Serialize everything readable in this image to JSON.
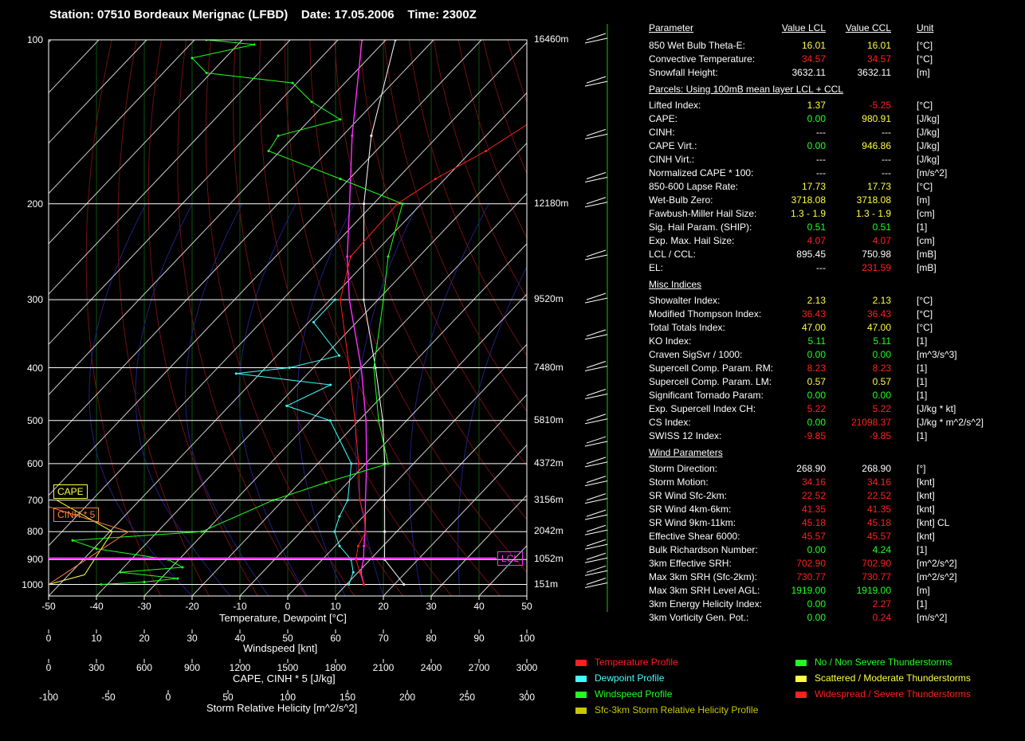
{
  "header": {
    "station": "Station: 07510 Bordeaux Merignac (LFBD)",
    "date": "Date: 17.05.2006",
    "time": "Time: 2300Z"
  },
  "colors": {
    "background": "#000000",
    "temperature": "#ff2020",
    "dewpoint": "#40ffff",
    "wind": "#20ff20",
    "parcel": "#ff30ff",
    "virt": "#ffffff",
    "srh": "#c8c800",
    "yellow": "#ffff40",
    "red": "#ff2020",
    "green": "#20ff20"
  },
  "chart_data": {
    "type": "line",
    "x_axis": {
      "label": "Temperature, Dewpoint  [°C]",
      "ticks": [
        "-50",
        "-40",
        "-30",
        "-20",
        "-10",
        "0",
        "10",
        "20",
        "30",
        "40",
        "50"
      ],
      "range": [
        -50,
        50
      ]
    },
    "wind_axis": {
      "label": "Windspeed  [knt]",
      "ticks": [
        "0",
        "10",
        "20",
        "30",
        "40",
        "50",
        "60",
        "70",
        "80",
        "90",
        "100"
      ]
    },
    "cape_axis": {
      "label": "CAPE, CINH * 5  [J/kg]",
      "ticks": [
        "0",
        "300",
        "600",
        "900",
        "1200",
        "1500",
        "1800",
        "2100",
        "2400",
        "2700",
        "3000"
      ]
    },
    "srh_axis": {
      "label": "Storm Relative Helicity  [m^2/s^2]",
      "ticks": [
        "-100",
        "-50",
        "0",
        "50",
        "100",
        "150",
        "200",
        "250",
        "300"
      ]
    },
    "pressure_levels": [
      {
        "p": 100,
        "label": "100",
        "height": "16460m"
      },
      {
        "p": 200,
        "label": "200",
        "height": "12180m"
      },
      {
        "p": 300,
        "label": "300",
        "height": "9520m"
      },
      {
        "p": 400,
        "label": "400",
        "height": "7480m"
      },
      {
        "p": 500,
        "label": "500",
        "height": "5810m"
      },
      {
        "p": 600,
        "label": "600",
        "height": "4372m"
      },
      {
        "p": 700,
        "label": "700",
        "height": "3156m"
      },
      {
        "p": 800,
        "label": "800",
        "height": "2042m"
      },
      {
        "p": 900,
        "label": "900",
        "height": "1052m"
      },
      {
        "p": 1000,
        "label": "1000",
        "height": "151m"
      }
    ],
    "temperature": [
      {
        "p": 1000,
        "t": 13.6
      },
      {
        "p": 950,
        "t": 10.4
      },
      {
        "p": 900,
        "t": 7.0
      },
      {
        "p": 850,
        "t": 4.8
      },
      {
        "p": 800,
        "t": 3.5
      },
      {
        "p": 750,
        "t": 0.2
      },
      {
        "p": 700,
        "t": -4.0
      },
      {
        "p": 600,
        "t": -11.5
      },
      {
        "p": 500,
        "t": -20.8
      },
      {
        "p": 400,
        "t": -32.5
      },
      {
        "p": 300,
        "t": -47.9
      },
      {
        "p": 250,
        "t": -54.3
      },
      {
        "p": 200,
        "t": -55.0
      },
      {
        "p": 180,
        "t": -52.0
      },
      {
        "p": 160,
        "t": -47.0
      },
      {
        "p": 140,
        "t": -43.0
      },
      {
        "p": 120,
        "t": -40.0
      },
      {
        "p": 110,
        "t": -39.0
      }
    ],
    "dewpoint": [
      {
        "p": 1000,
        "t": 10.5
      },
      {
        "p": 950,
        "t": 9.0
      },
      {
        "p": 900,
        "t": 6.0
      },
      {
        "p": 850,
        "t": 0.9
      },
      {
        "p": 800,
        "t": -3.0
      },
      {
        "p": 750,
        "t": -5.0
      },
      {
        "p": 700,
        "t": -6.5
      },
      {
        "p": 600,
        "t": -13.0
      },
      {
        "p": 500,
        "t": -26.0
      },
      {
        "p": 470,
        "t": -38.0
      },
      {
        "p": 430,
        "t": -33.0
      },
      {
        "p": 410,
        "t": -55.0
      },
      {
        "p": 400,
        "t": -45.0
      },
      {
        "p": 380,
        "t": -37.0
      },
      {
        "p": 330,
        "t": -49.0
      },
      {
        "p": 300,
        "t": -49.0
      }
    ],
    "parcel": [
      {
        "p": 1000,
        "t": 13.6
      },
      {
        "p": 950,
        "t": 10.6
      },
      {
        "p": 900,
        "t": 8.6
      },
      {
        "p": 850,
        "t": 6.0
      },
      {
        "p": 800,
        "t": 3.4
      },
      {
        "p": 700,
        "t": -2.8
      },
      {
        "p": 600,
        "t": -9.8
      },
      {
        "p": 500,
        "t": -18.5
      },
      {
        "p": 400,
        "t": -30.0
      },
      {
        "p": 300,
        "t": -46.0
      },
      {
        "p": 250,
        "t": -55.0
      },
      {
        "p": 200,
        "t": -65.0
      },
      {
        "p": 150,
        "t": -78.0
      },
      {
        "p": 100,
        "t": -95.0
      }
    ],
    "virtual": [
      {
        "p": 1000,
        "t": 22.0
      },
      {
        "p": 900,
        "t": 13.0
      },
      {
        "p": 800,
        "t": 7.5
      },
      {
        "p": 700,
        "t": 1.2
      },
      {
        "p": 600,
        "t": -6.0
      },
      {
        "p": 500,
        "t": -15.0
      },
      {
        "p": 400,
        "t": -27.0
      },
      {
        "p": 300,
        "t": -43.0
      },
      {
        "p": 200,
        "t": -62.0
      },
      {
        "p": 150,
        "t": -74.0
      },
      {
        "p": 100,
        "t": -88.0
      }
    ],
    "windspeed": [
      {
        "p": 1000,
        "v": 11
      },
      {
        "p": 990,
        "v": 20
      },
      {
        "p": 975,
        "v": 27
      },
      {
        "p": 950,
        "v": 15
      },
      {
        "p": 930,
        "v": 28
      },
      {
        "p": 900,
        "v": 25
      },
      {
        "p": 860,
        "v": 10
      },
      {
        "p": 830,
        "v": 5
      },
      {
        "p": 800,
        "v": 32
      },
      {
        "p": 700,
        "v": 47
      },
      {
        "p": 650,
        "v": 58
      },
      {
        "p": 600,
        "v": 71
      },
      {
        "p": 500,
        "v": 69
      },
      {
        "p": 400,
        "v": 68
      },
      {
        "p": 300,
        "v": 70
      },
      {
        "p": 250,
        "v": 71
      },
      {
        "p": 200,
        "v": 74
      },
      {
        "p": 180,
        "v": 61
      },
      {
        "p": 160,
        "v": 46
      },
      {
        "p": 150,
        "v": 48
      },
      {
        "p": 140,
        "v": 61
      },
      {
        "p": 130,
        "v": 55
      },
      {
        "p": 120,
        "v": 51
      },
      {
        "p": 115,
        "v": 33
      },
      {
        "p": 108,
        "v": 30
      },
      {
        "p": 102,
        "v": 43
      },
      {
        "p": 100,
        "v": 33
      }
    ],
    "indicators": {
      "cape_label": "CAPE",
      "cinh_label": "CINH * 5",
      "lcl_label": "LCL"
    }
  },
  "table": {
    "header": {
      "name": "Parameter",
      "lcl": "Value LCL",
      "ccl": "Value CCL",
      "unit": "Unit"
    },
    "rows": [
      {
        "name": "850 Wet Bulb Theta-E:",
        "lcl": "16.01",
        "ccl": "16.01",
        "unit": "[°C]",
        "cl": "yellow",
        "cc": "yellow"
      },
      {
        "name": "Convective Temperature:",
        "lcl": "34.57",
        "ccl": "34.57",
        "unit": "[°C]",
        "cl": "red",
        "cc": "red"
      },
      {
        "name": "Snowfall Height:",
        "lcl": "3632.11",
        "ccl": "3632.11",
        "unit": "[m]",
        "cl": "white",
        "cc": "white"
      },
      {
        "section": "Parcels: Using 100mB mean layer LCL + CCL"
      },
      {
        "name": "Lifted Index:",
        "lcl": "1.37",
        "ccl": "-5.25",
        "unit": "[°C]",
        "cl": "yellow",
        "cc": "red"
      },
      {
        "name": "CAPE:",
        "lcl": "0.00",
        "ccl": "980.91",
        "unit": "[J/kg]",
        "cl": "green",
        "cc": "yellow"
      },
      {
        "name": "CINH:",
        "lcl": "---",
        "ccl": "---",
        "unit": "[J/kg]",
        "cl": "white",
        "cc": "white"
      },
      {
        "name": "CAPE Virt.:",
        "lcl": "0.00",
        "ccl": "946.86",
        "unit": "[J/kg]",
        "cl": "green",
        "cc": "yellow"
      },
      {
        "name": "CINH Virt.:",
        "lcl": "---",
        "ccl": "---",
        "unit": "[J/kg]",
        "cl": "white",
        "cc": "white"
      },
      {
        "name": "Normalized CAPE * 100:",
        "lcl": "---",
        "ccl": "---",
        "unit": "[m/s^2]",
        "cl": "white",
        "cc": "white"
      },
      {
        "name": "850-600 Lapse Rate:",
        "lcl": "17.73",
        "ccl": "17.73",
        "unit": "[°C]",
        "cl": "yellow",
        "cc": "yellow"
      },
      {
        "name": "Wet-Bulb Zero:",
        "lcl": "3718.08",
        "ccl": "3718.08",
        "unit": "[m]",
        "cl": "yellow",
        "cc": "yellow"
      },
      {
        "name": "Fawbush-Miller Hail Size:",
        "lcl": "1.3 - 1.9",
        "ccl": "1.3 - 1.9",
        "unit": "[cm]",
        "cl": "yellow",
        "cc": "yellow"
      },
      {
        "name": "Sig. Hail Param. (SHIP):",
        "lcl": "0.51",
        "ccl": "0.51",
        "unit": "[1]",
        "cl": "green",
        "cc": "green"
      },
      {
        "name": "Exp. Max. Hail Size:",
        "lcl": "4.07",
        "ccl": "4.07",
        "unit": "[cm]",
        "cl": "red",
        "cc": "red"
      },
      {
        "name": "LCL / CCL:",
        "lcl": "895.45",
        "ccl": "750.98",
        "unit": "[mB]",
        "cl": "white",
        "cc": "white"
      },
      {
        "name": "EL:",
        "lcl": "---",
        "ccl": "231.59",
        "unit": "[mB]",
        "cl": "white",
        "cc": "red"
      },
      {
        "section": "Misc Indices"
      },
      {
        "name": "Showalter Index:",
        "lcl": "2.13",
        "ccl": "2.13",
        "unit": "[°C]",
        "cl": "yellow",
        "cc": "yellow"
      },
      {
        "name": "Modified Thompson Index:",
        "lcl": "36.43",
        "ccl": "36.43",
        "unit": "[°C]",
        "cl": "red",
        "cc": "red"
      },
      {
        "name": "Total Totals Index:",
        "lcl": "47.00",
        "ccl": "47.00",
        "unit": "[°C]",
        "cl": "yellow",
        "cc": "yellow"
      },
      {
        "name": "KO Index:",
        "lcl": "5.11",
        "ccl": "5.11",
        "unit": "[1]",
        "cl": "green",
        "cc": "green"
      },
      {
        "name": "Craven SigSvr / 1000:",
        "lcl": "0.00",
        "ccl": "0.00",
        "unit": "[m^3/s^3]",
        "cl": "green",
        "cc": "green"
      },
      {
        "name": "Supercell Comp. Param. RM:",
        "lcl": "8.23",
        "ccl": "8.23",
        "unit": "[1]",
        "cl": "red",
        "cc": "red"
      },
      {
        "name": "Supercell Comp. Param. LM:",
        "lcl": "0.57",
        "ccl": "0.57",
        "unit": "[1]",
        "cl": "yellow",
        "cc": "yellow"
      },
      {
        "name": "Significant Tornado Param:",
        "lcl": "0.00",
        "ccl": "0.00",
        "unit": "[1]",
        "cl": "green",
        "cc": "green"
      },
      {
        "name": "Exp. Supercell Index CH:",
        "lcl": "5.22",
        "ccl": "5.22",
        "unit": "[J/kg * kt]",
        "cl": "red",
        "cc": "red"
      },
      {
        "name": "CS Index:",
        "lcl": "0.00",
        "ccl": "21098.37",
        "unit": "[J/kg * m^2/s^2]",
        "cl": "green",
        "cc": "red"
      },
      {
        "name": "SWISS 12 Index:",
        "lcl": "-9.85",
        "ccl": "-9.85",
        "unit": "[1]",
        "cl": "red",
        "cc": "red"
      },
      {
        "section": "Wind Parameters"
      },
      {
        "name": "Storm Direction:",
        "lcl": "268.90",
        "ccl": "268.90",
        "unit": "[°]",
        "cl": "white",
        "cc": "white"
      },
      {
        "name": "Storm Motion:",
        "lcl": "34.16",
        "ccl": "34.16",
        "unit": "[knt]",
        "cl": "red",
        "cc": "red"
      },
      {
        "name": "SR Wind Sfc-2km:",
        "lcl": "22.52",
        "ccl": "22.52",
        "unit": "[knt]",
        "cl": "red",
        "cc": "red"
      },
      {
        "name": "SR Wind 4km-6km:",
        "lcl": "41.35",
        "ccl": "41.35",
        "unit": "[knt]",
        "cl": "red",
        "cc": "red"
      },
      {
        "name": "SR Wind 9km-11km:",
        "lcl": "45.18",
        "ccl": "45.18",
        "unit": "[knt] CL",
        "cl": "red",
        "cc": "red"
      },
      {
        "name": "Effective Shear 6000:",
        "lcl": "45.57",
        "ccl": "45.57",
        "unit": "[knt]",
        "cl": "red",
        "cc": "red"
      },
      {
        "name": "Bulk Richardson Number:",
        "lcl": "0.00",
        "ccl": "4.24",
        "unit": "[1]",
        "cl": "green",
        "cc": "green"
      },
      {
        "name": "3km Effective SRH:",
        "lcl": "702.90",
        "ccl": "702.90",
        "unit": "[m^2/s^2]",
        "cl": "red",
        "cc": "red"
      },
      {
        "name": "Max 3km SRH (Sfc-2km):",
        "lcl": "730.77",
        "ccl": "730.77",
        "unit": "[m^2/s^2]",
        "cl": "red",
        "cc": "red"
      },
      {
        "name": "Max 3km SRH Level AGL:",
        "lcl": "1919.00",
        "ccl": "1919.00",
        "unit": "[m]",
        "cl": "green",
        "cc": "green"
      },
      {
        "name": "3km Energy Helicity Index:",
        "lcl": "0.00",
        "ccl": "2.27",
        "unit": "[1]",
        "cl": "green",
        "cc": "red"
      },
      {
        "name": "3km Vorticity Gen. Pot.:",
        "lcl": "0.00",
        "ccl": "0.24",
        "unit": "[m/s^2]",
        "cl": "green",
        "cc": "red"
      }
    ]
  },
  "legend": [
    {
      "label": "Temperature Profile",
      "color": "#ff2020"
    },
    {
      "label": "Dewpoint Profile",
      "color": "#40ffff"
    },
    {
      "label": "Windspeed Profile",
      "color": "#20ff20"
    },
    {
      "label": "Sfc-3km Storm Relative Helicity Profile",
      "color": "#c8c800"
    },
    {
      "label": "No / Non Severe Thunderstorms",
      "color": "#20ff20"
    },
    {
      "label": "Scattered / Moderate Thunderstorms",
      "color": "#ffff40"
    },
    {
      "label": "Widespread / Severe Thunderstorms",
      "color": "#ff2020"
    }
  ]
}
